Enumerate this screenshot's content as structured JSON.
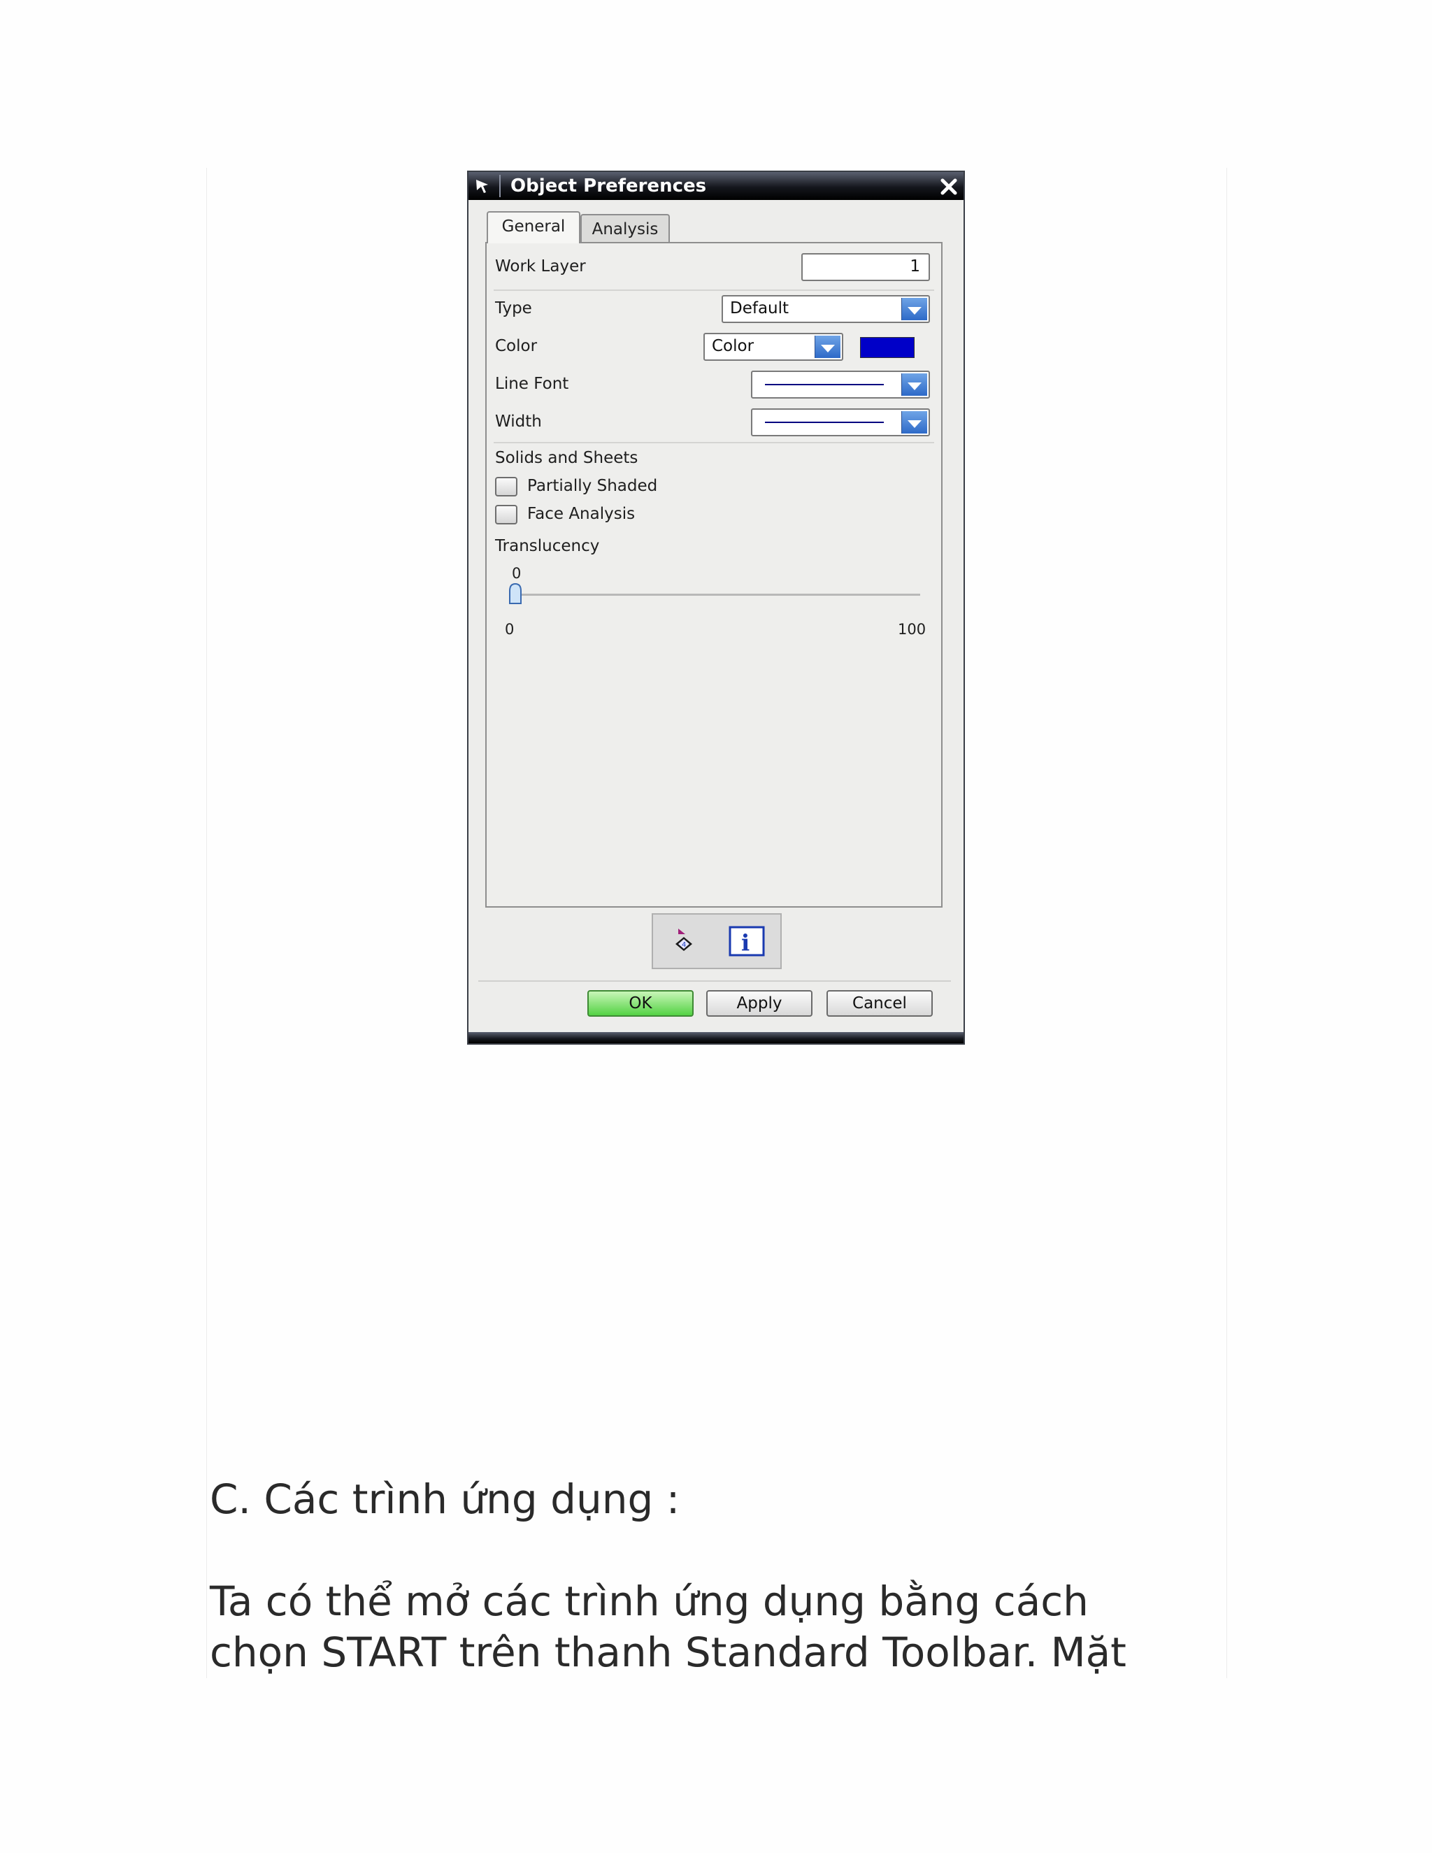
{
  "dialog": {
    "title": "Object Preferences",
    "tabs": [
      {
        "label": "General",
        "selected": true
      },
      {
        "label": "Analysis",
        "selected": false
      }
    ],
    "work_layer": {
      "label": "Work Layer",
      "value": "1"
    },
    "type": {
      "label": "Type",
      "value": "Default"
    },
    "color": {
      "label": "Color",
      "value": "Color",
      "swatch": "#0000c8"
    },
    "line_font": {
      "label": "Line Font"
    },
    "width": {
      "label": "Width"
    },
    "solids_sheets": {
      "label": "Solids and Sheets",
      "partially_shaded": {
        "label": "Partially Shaded",
        "checked": false
      },
      "face_analysis": {
        "label": "Face Analysis",
        "checked": false
      }
    },
    "translucency": {
      "label": "Translucency",
      "value": "0",
      "min": "0",
      "max": "100"
    },
    "buttons": {
      "ok": "OK",
      "apply": "Apply",
      "cancel": "Cancel"
    },
    "icons": [
      "reset-preferences-icon",
      "info-icon"
    ]
  },
  "document": {
    "heading": "C. Các trình ứng dụng :",
    "paragraph_lines": [
      "Ta có thể mở các trình ứng dụng bằng cách",
      "chọn START trên thanh Standard Toolbar. Mặt"
    ]
  }
}
